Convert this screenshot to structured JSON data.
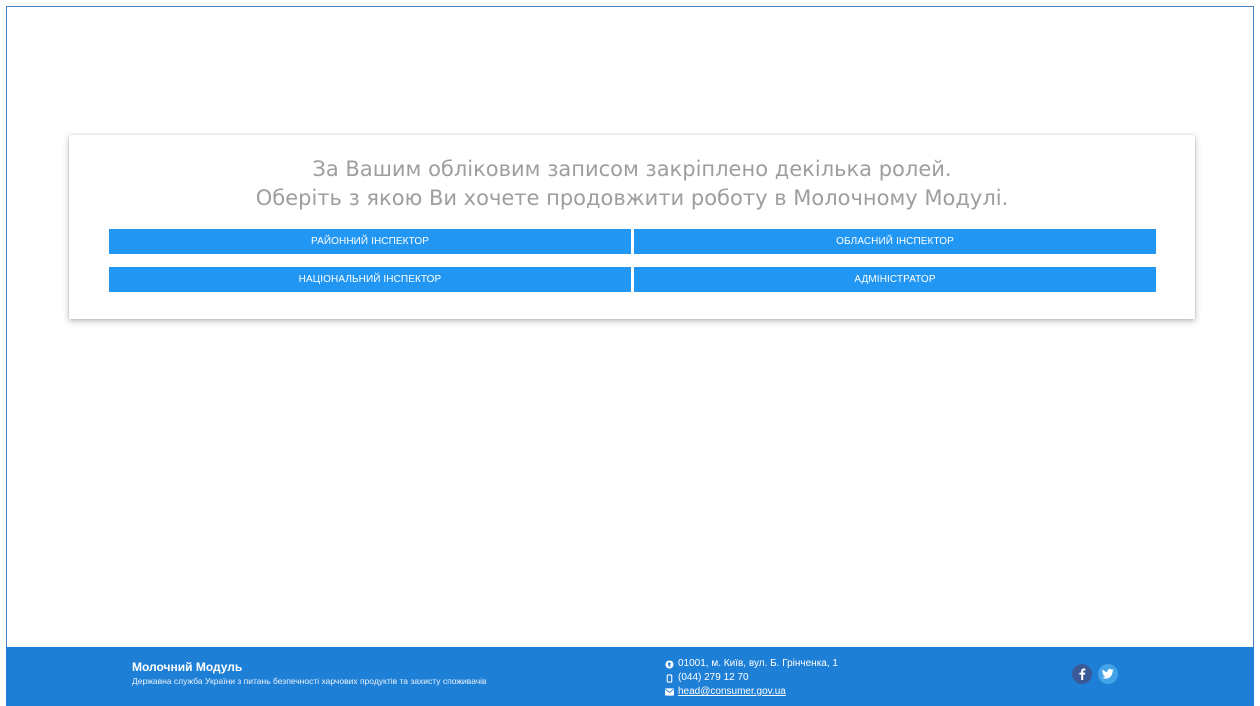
{
  "role_selection": {
    "heading_line1": "За Вашим обліковим записом закріплено декілька ролей.",
    "heading_line2": "Оберіть з якою Ви хочете продовжити роботу в Молочному Модулі.",
    "roles": [
      {
        "label": "РАЙОННИЙ ІНСПЕКТОР"
      },
      {
        "label": "ОБЛАСНИЙ ІНСПЕКТОР"
      },
      {
        "label": "НАЦІОНАЛЬНИЙ ІНСПЕКТОР"
      },
      {
        "label": "АДМІНІСТРАТОР"
      }
    ],
    "button_color": "#2196f3"
  },
  "footer": {
    "title": "Молочний Модуль",
    "subtitle": "Державна служба України з питань безпечності харчових продуктів та захисту споживачів",
    "address": "01001, м. Київ, вул. Б. Грінченка, 1",
    "phone": "(044) 279 12 70",
    "email": "head@consumer.gov.ua",
    "social": [
      {
        "icon": "facebook-icon"
      },
      {
        "icon": "twitter-icon"
      }
    ],
    "background_color": "#1e7fd6"
  }
}
